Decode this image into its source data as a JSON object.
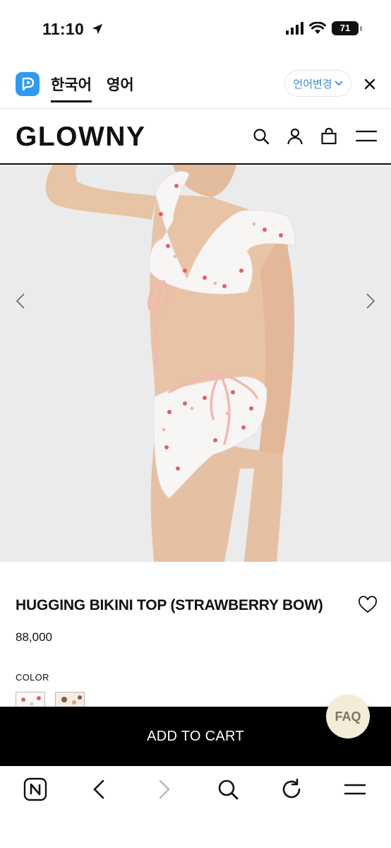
{
  "status": {
    "time": "11:10",
    "battery": "71"
  },
  "translate": {
    "active_lang": "한국어",
    "other_lang": "영어",
    "change_label": "언어변경"
  },
  "header": {
    "logo": "GLOWNY"
  },
  "product": {
    "title": "HUGGING BIKINI TOP (STRAWBERRY BOW)",
    "price": "88,000",
    "color_label": "COLOR"
  },
  "cart": {
    "label": "ADD TO CART"
  },
  "faq": {
    "label": "FAQ"
  },
  "icons": {
    "location": "location-arrow-icon",
    "signal": "cellular-signal-icon",
    "wifi": "wifi-icon",
    "battery": "battery-icon",
    "papago": "papago-logo-icon",
    "search": "search-icon",
    "account": "user-icon",
    "bag": "shopping-bag-icon",
    "menu": "hamburger-menu-icon",
    "heart": "heart-icon"
  },
  "colors": {
    "accent_blue": "#3a8ad8",
    "cart_bg": "#000000",
    "faq_bg": "#f3ecd9",
    "bikini_pink": "#f3b8b0"
  }
}
